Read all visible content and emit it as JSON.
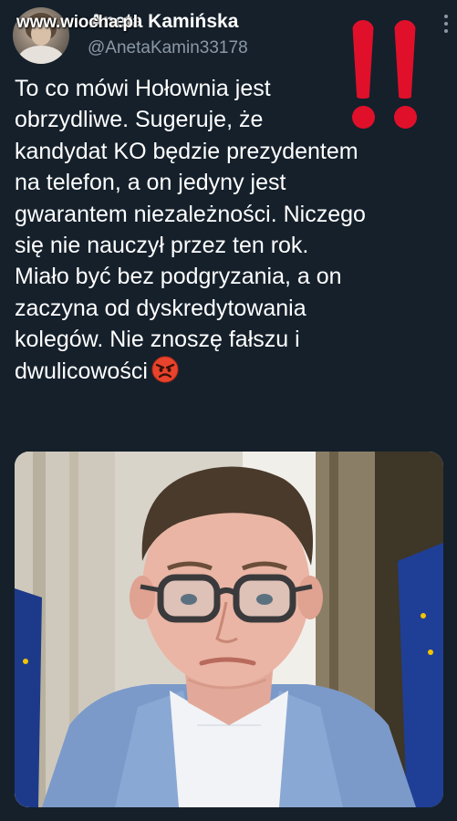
{
  "watermark": "www.wiocha.pl",
  "author": {
    "display_name": "Aneta Kamińska",
    "handle": "@AnetaKamin33178"
  },
  "tweet": {
    "lines": [
      "To co mówi Hołownia jest",
      "obrzydliwe. Sugeruje, że",
      "kandydat KO będzie prezydentem",
      "na telefon, a on jedyny jest",
      "gwarantem niezależności. Niczego",
      "się nie nauczył przez ten rok.",
      "Miało być bez podgryzania, a on",
      "zaczyna od dyskredytowania",
      "kolegów. Nie znoszę fałszu i",
      "dwulicowości"
    ]
  },
  "icons": {
    "overlay": "double-exclamation-icon",
    "emoji": "angry-face-icon",
    "menu": "more-options-icon"
  },
  "colors": {
    "background": "#15202b",
    "text_primary": "#ffffff",
    "text_secondary": "#8b98a5",
    "exclamation_red": "#e0102a"
  }
}
